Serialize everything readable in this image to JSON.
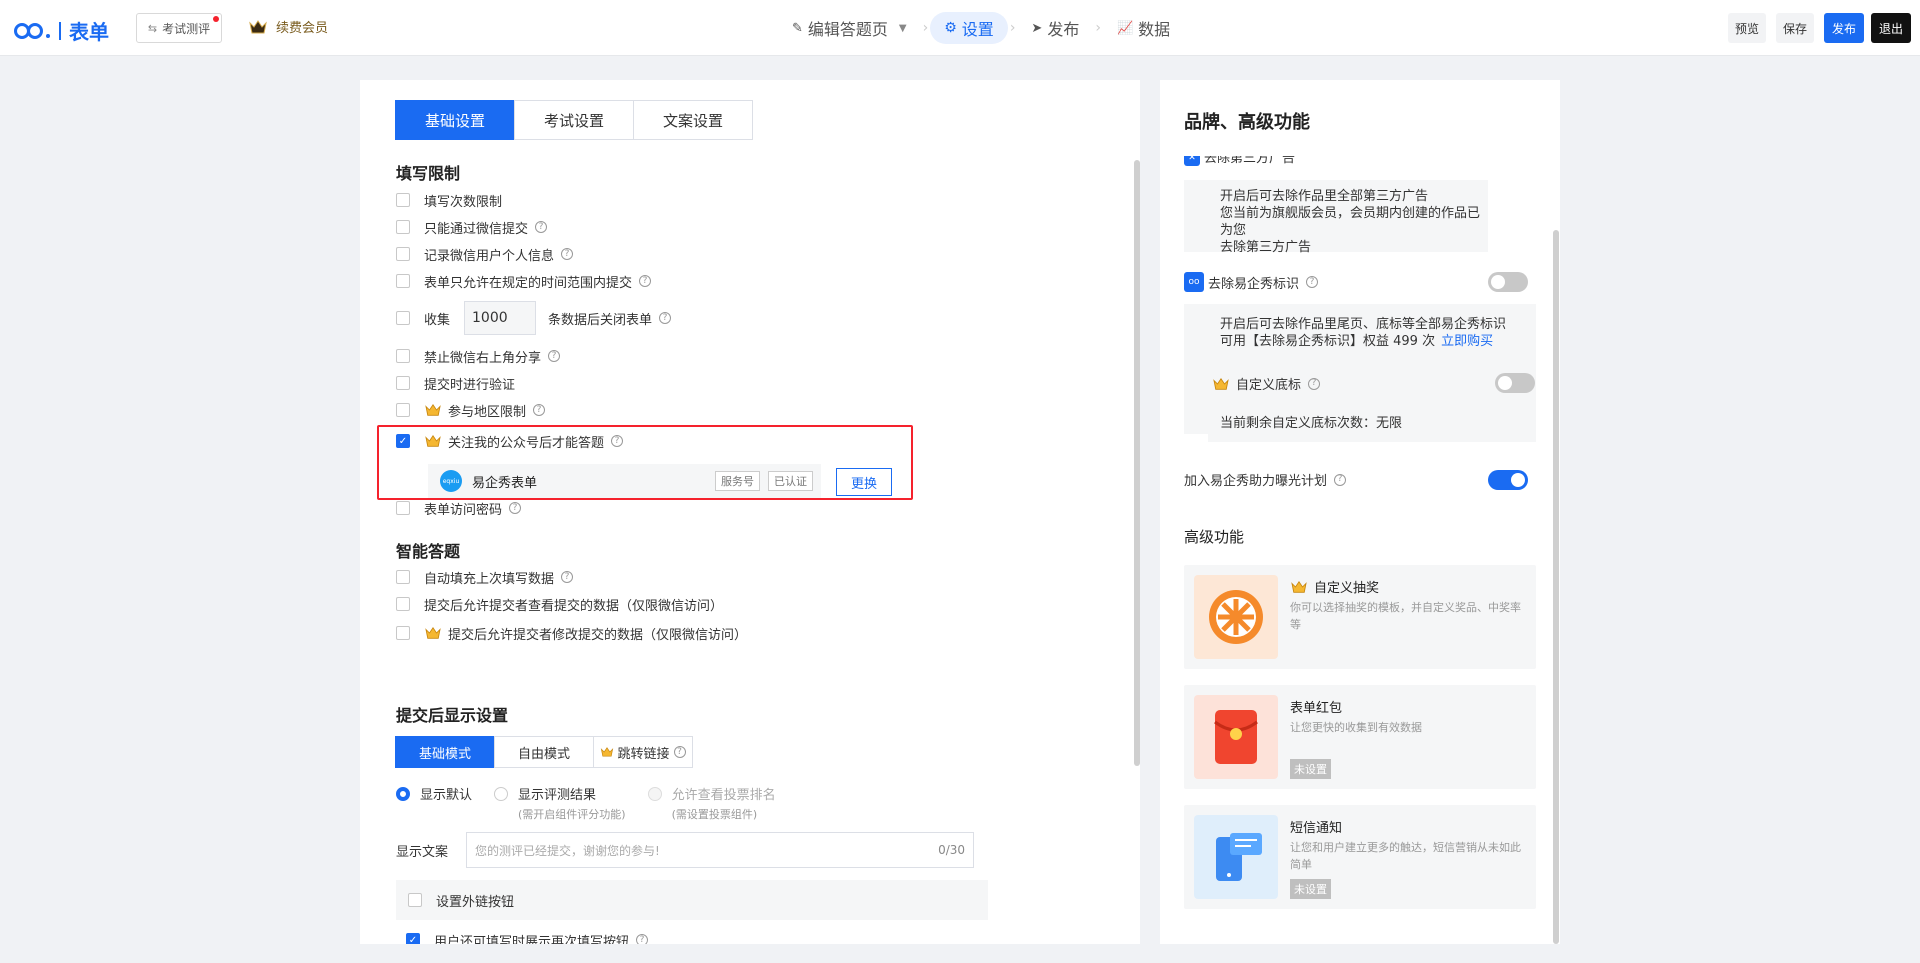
{
  "header": {
    "logo_text": "表单",
    "test_button": "考试测评",
    "vip_label": "续费会员",
    "nav": [
      {
        "label": "编辑答题页"
      },
      {
        "label": "设置"
      },
      {
        "label": "发布"
      },
      {
        "label": "数据"
      }
    ],
    "preview": "预览",
    "save": "保存",
    "publish": "发布",
    "logout": "退出"
  },
  "tabs": [
    "基础设置",
    "考试设置",
    "文案设置"
  ],
  "fill_limits": {
    "title": "填写限制",
    "items": [
      "填写次数限制",
      "只能通过微信提交",
      "记录微信用户个人信息",
      "表单只允许在规定的时间范围内提交"
    ],
    "collect_prefix": "收集",
    "collect_value": "1000",
    "collect_suffix": "条数据后关闭表单",
    "items2": [
      "禁止微信右上角分享",
      "提交时进行验证",
      "参与地区限制",
      "关注我的公众号后才能答题"
    ],
    "wechat": {
      "name": "易企秀表单",
      "tag1": "服务号",
      "tag2": "已认证",
      "change": "更换",
      "avatar_text": "eqxiu"
    },
    "password": "表单访问密码"
  },
  "smart": {
    "title": "智能答题",
    "items": [
      "自动填充上次填写数据",
      "提交后允许提交者查看提交的数据（仅限微信访问）",
      "提交后允许提交者修改提交的数据（仅限微信访问）"
    ]
  },
  "after_submit": {
    "title": "提交后显示设置",
    "modes": [
      "基础模式",
      "自由模式",
      "跳转链接"
    ],
    "radios": [
      {
        "label": "显示默认",
        "sub": ""
      },
      {
        "label": "显示评测结果",
        "sub": "(需开启组件评分功能)"
      },
      {
        "label": "允许查看投票排名",
        "sub": "(需设置投票组件)"
      }
    ],
    "text_label": "显示文案",
    "text_placeholder": "您的测评已经提交，谢谢您的参与!",
    "text_count": "0/30",
    "ext_link": "设置外链按钮",
    "refill": "用户还可填写时展示再次填写按钮"
  },
  "right": {
    "title": "品牌、高级功能",
    "remove_ads_partial": "去除第三方广告",
    "remove_ads_desc": [
      "开启后可去除作品里全部第三方广告",
      "您当前为旗舰版会员，会员期内创建的作品已为您",
      "去除第三方广告"
    ],
    "remove_brand": "去除易企秀标识",
    "remove_brand_desc1": "开启后可去除作品里尾页、底标等全部易企秀标识",
    "remove_brand_desc2": "可用【去除易企秀标识】权益 499 次",
    "buy_link": "立即购买",
    "custom_mark": "自定义底标",
    "custom_mark_desc": "当前剩余自定义底标次数：无限",
    "boost_plan": "加入易企秀助力曝光计划",
    "advanced_title": "高级功能",
    "cards": [
      {
        "title": "自定义抽奖",
        "desc": "你可以选择抽奖的模板，并自定义奖品、中奖率等",
        "badge": ""
      },
      {
        "title": "表单红包",
        "desc": "让您更快的收集到有效数据",
        "badge": "未设置"
      },
      {
        "title": "短信通知",
        "desc": "让您和用户建立更多的触达，短信营销从未如此简单",
        "badge": "未设置"
      }
    ]
  },
  "colors": {
    "accent": "#1a6bf2",
    "highlight": "#f5222d"
  }
}
